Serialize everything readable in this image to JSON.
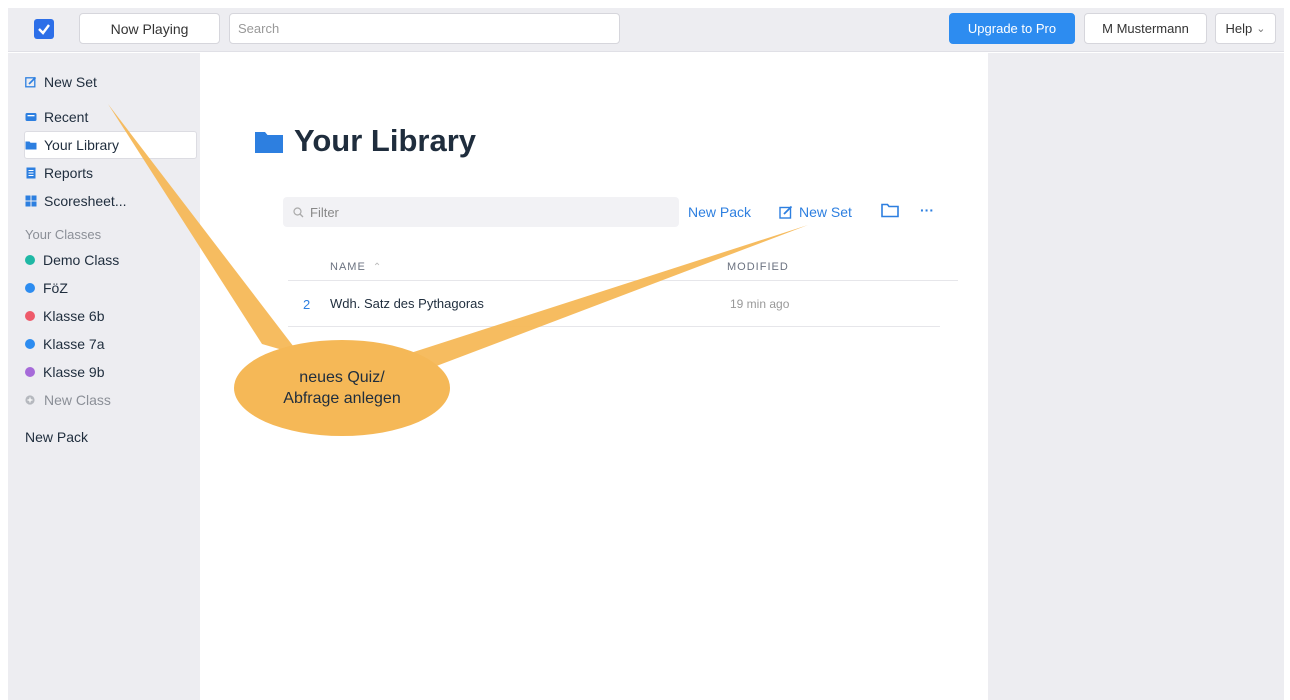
{
  "header": {
    "now_playing_label": "Now Playing",
    "search_placeholder": "Search",
    "upgrade_label": "Upgrade to Pro",
    "user_name": "M Mustermann",
    "help_label": "Help",
    "help_chevron": "⌄"
  },
  "sidebar": {
    "items": [
      {
        "label": "New Set",
        "icon": "edit-icon"
      },
      {
        "label": "Recent",
        "icon": "recent-icon"
      },
      {
        "label": "Your Library",
        "icon": "folder-icon"
      },
      {
        "label": "Reports",
        "icon": "reports-icon"
      },
      {
        "label": "Scoresheet...",
        "icon": "grid-icon"
      }
    ],
    "classes_heading": "Your Classes",
    "classes": [
      {
        "label": "Demo Class",
        "color": "#1fb8a5"
      },
      {
        "label": "FöZ",
        "color": "#2d8cf0"
      },
      {
        "label": "Klasse 6b",
        "color": "#ee5a6a"
      },
      {
        "label": "Klasse 7a",
        "color": "#2d8cf0"
      },
      {
        "label": "Klasse 9b",
        "color": "#a66ad9"
      }
    ],
    "new_class_label": "New Class",
    "new_pack_label": "New Pack"
  },
  "main": {
    "title": "Your Library",
    "filter_placeholder": "Filter",
    "new_pack_label": "New Pack",
    "new_set_label": "New Set",
    "more_label": "···",
    "columns": {
      "name": "NAME",
      "modified": "MODIFIED"
    },
    "rows": [
      {
        "count": "2",
        "name": "Wdh. Satz des Pythagoras",
        "modified": "19 min ago"
      }
    ]
  },
  "annotation": {
    "line1": "neues Quiz/",
    "line2": "Abfrage anlegen",
    "color": "#f5b857"
  },
  "colors": {
    "accent": "#2d8cf0",
    "link": "#2d7fe0",
    "sidebar_bg": "#ededf1"
  }
}
